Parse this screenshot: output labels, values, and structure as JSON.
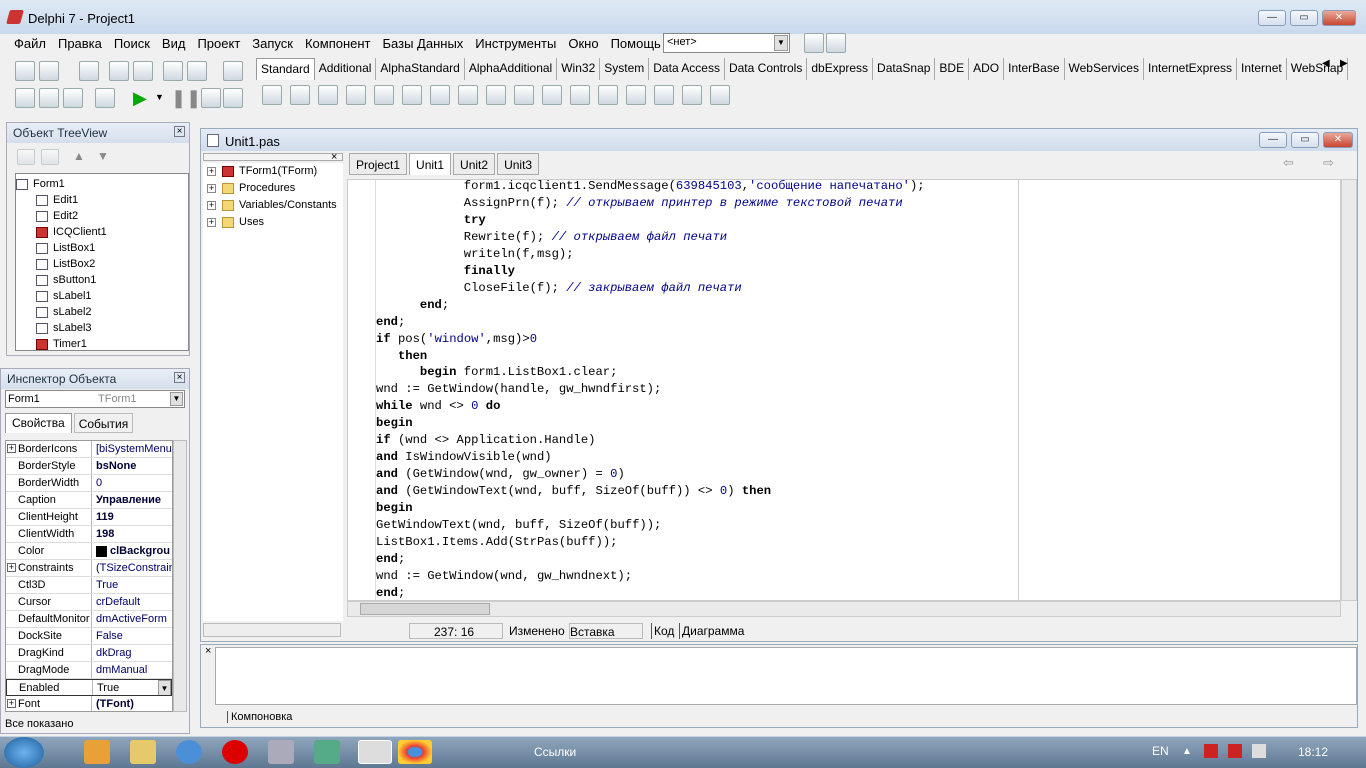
{
  "window": {
    "title": "Delphi 7 - Project1"
  },
  "menu": [
    "Файл",
    "Правка",
    "Поиск",
    "Вид",
    "Проект",
    "Запуск",
    "Компонент",
    "Базы Данных",
    "Инструменты",
    "Окно",
    "Помощь"
  ],
  "desktop_select": "<нет>",
  "palette_tabs": [
    "Standard",
    "Additional",
    "AlphaStandard",
    "AlphaAdditional",
    "Win32",
    "System",
    "Data Access",
    "Data Controls",
    "dbExpress",
    "DataSnap",
    "BDE",
    "ADO",
    "InterBase",
    "WebServices",
    "InternetExpress",
    "Internet",
    "WebSnap"
  ],
  "treeview": {
    "title": "Объект TreeView",
    "root": "Form1",
    "items": [
      "Edit1",
      "Edit2",
      "ICQClient1",
      "ListBox1",
      "ListBox2",
      "sButton1",
      "sLabel1",
      "sLabel2",
      "sLabel3",
      "Timer1"
    ]
  },
  "inspector": {
    "title": "Инспектор Объекта",
    "object": "Form1",
    "object_type": "TForm1",
    "tabs": [
      "Свойства",
      "События"
    ],
    "rows": [
      {
        "k": "BorderIcons",
        "v": "[biSystemMenu,b",
        "plus": true
      },
      {
        "k": "BorderStyle",
        "v": "bsNone",
        "bold": true
      },
      {
        "k": "BorderWidth",
        "v": "0"
      },
      {
        "k": "Caption",
        "v": "Управление",
        "bold": true
      },
      {
        "k": "ClientHeight",
        "v": "119",
        "bold": true
      },
      {
        "k": "ClientWidth",
        "v": "198",
        "bold": true
      },
      {
        "k": "Color",
        "v": "clBackgrou",
        "bold": true
      },
      {
        "k": "Constraints",
        "v": "(TSizeConstrain",
        "plus": true
      },
      {
        "k": "Ctl3D",
        "v": "True"
      },
      {
        "k": "Cursor",
        "v": "crDefault"
      },
      {
        "k": "DefaultMonitor",
        "v": "dmActiveForm"
      },
      {
        "k": "DockSite",
        "v": "False"
      },
      {
        "k": "DragKind",
        "v": "dkDrag"
      },
      {
        "k": "DragMode",
        "v": "dmManual"
      },
      {
        "k": "Enabled",
        "v": "True"
      },
      {
        "k": "Font",
        "v": "(TFont)",
        "bold": true,
        "plus": true
      }
    ],
    "status": "Все показано"
  },
  "editor": {
    "title": "Unit1.pas",
    "tabs": [
      "Project1",
      "Unit1",
      "Unit2",
      "Unit3"
    ],
    "explorer": [
      "TForm1(TForm)",
      "Procedures",
      "Variables/Constants",
      "Uses"
    ],
    "status_pos": "237: 16",
    "status_mod": "Изменено",
    "status_mode": "Вставка",
    "bottom_tabs": [
      "Код",
      "Диаграмма"
    ],
    "code": [
      "            form1.icqclient1.SendMessage(639845103,'сообщение напечатано');",
      "            AssignPrn(f); // открываем принтер в режиме текстовой печати",
      "            try",
      "            Rewrite(f); // открываем файл печати",
      "            writeln(f,msg);",
      "            finally",
      "            CloseFile(f); // закрываем файл печати",
      "      end;",
      "end;",
      "if pos('window',msg)>0",
      "   then",
      "      begin form1.ListBox1.clear;",
      "wnd := GetWindow(handle, gw_hwndfirst);",
      "while wnd <> 0 do",
      "begin",
      "if (wnd <> Application.Handle)",
      "and IsWindowVisible(wnd)",
      "and (GetWindow(wnd, gw_owner) = 0)",
      "and (GetWindowText(wnd, buff, SizeOf(buff)) <> 0) then",
      "begin",
      "GetWindowText(wnd, buff, SizeOf(buff));",
      "ListBox1.Items.Add(StrPas(buff));",
      "end;",
      "wnd := GetWindow(wnd, gw_hwndnext);",
      "end;"
    ]
  },
  "messages": {
    "tab": "Компоновка"
  },
  "taskbar": {
    "center": "Ссылки",
    "lang": "EN",
    "clock": "18:12"
  }
}
